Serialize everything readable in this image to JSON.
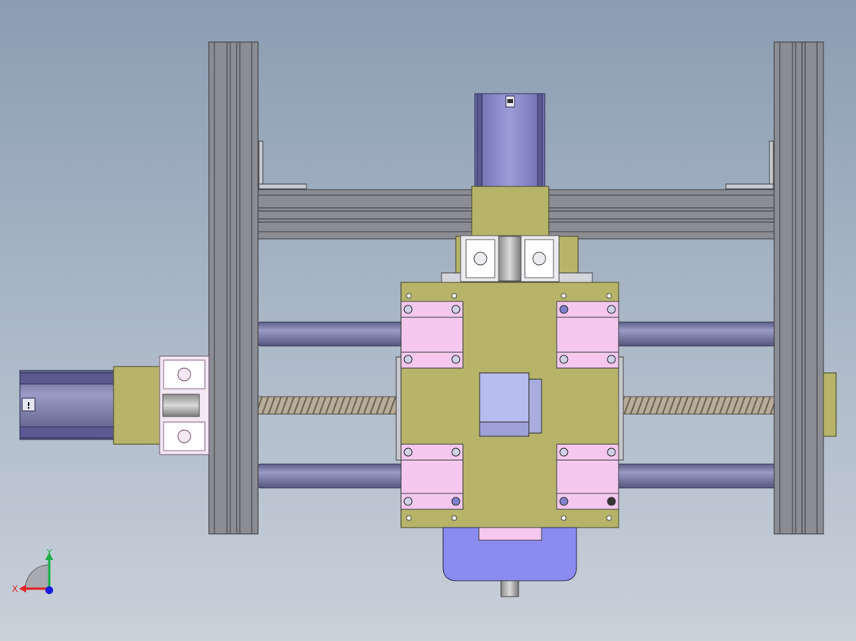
{
  "viewport": {
    "background_top": "#8b9db3",
    "background_bottom": "#c5ced8"
  },
  "colors": {
    "frame_gray": "#7f8185",
    "frame_dark": "#4a4c50",
    "rail_purple": "#6e6f9a",
    "motor_blue": "#8a8ac6",
    "bracket_olive": "#b7b46a",
    "bearing_pink": "#f6c8f0",
    "profile_white": "#e9e9ec",
    "nut_lavender": "#b8bdf0",
    "screw_tan": "#a69c8a",
    "axis_red": "#e0242a",
    "axis_green": "#1fb04a",
    "axis_blue": "#1a1ee0"
  },
  "icons": {
    "motor_label_icon": "exclamation-label-icon",
    "motor_top_label_icon": "small-nameplate-icon"
  },
  "triad": {
    "x_label": "X",
    "y_label": "Y",
    "x_color": "#e0242a",
    "y_color": "#1fb04a"
  },
  "motor_left": {
    "label_glyph": "!"
  }
}
